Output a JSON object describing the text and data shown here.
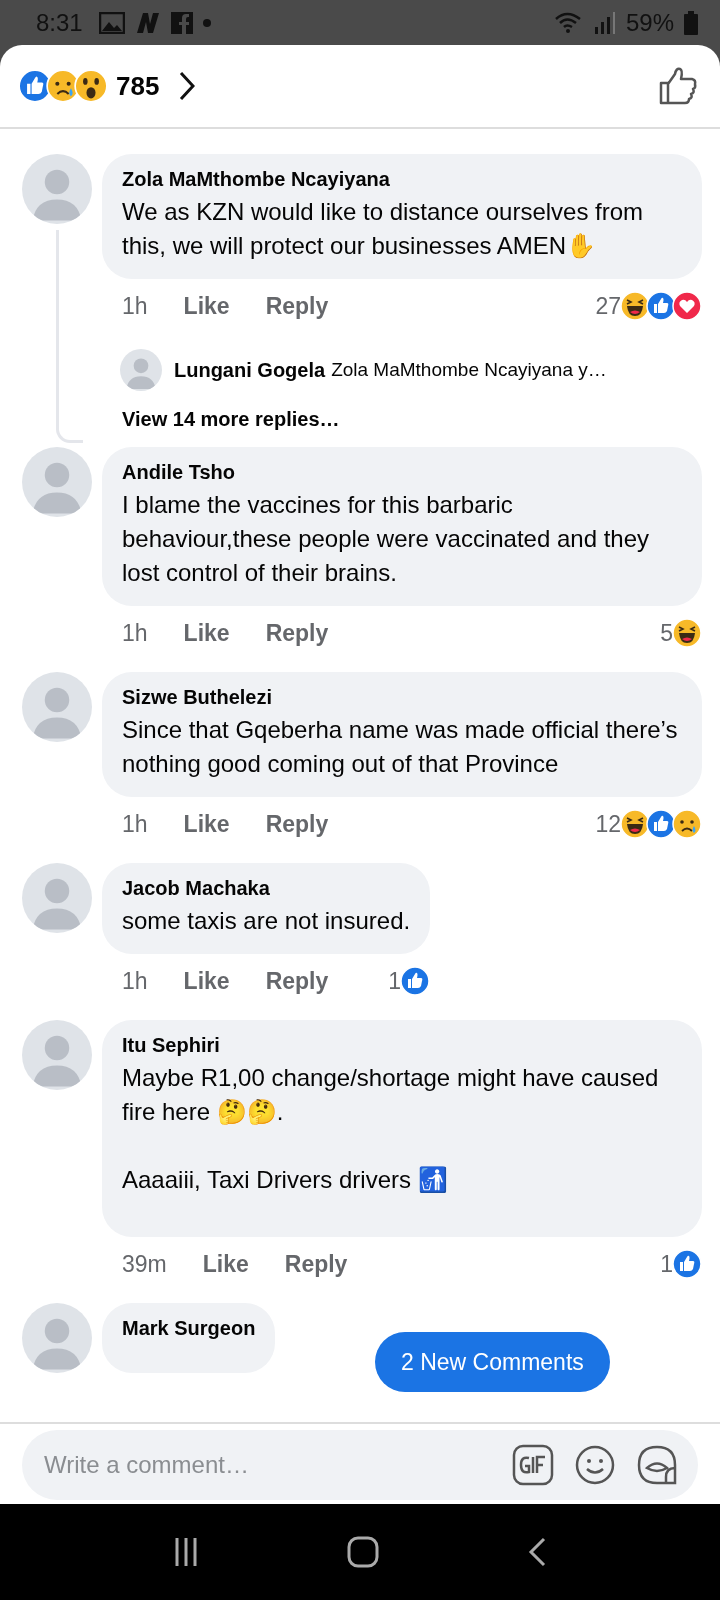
{
  "status_bar": {
    "time": "8:31",
    "battery": "59%"
  },
  "header": {
    "reactions": [
      {
        "kind": "like"
      },
      {
        "kind": "sad"
      },
      {
        "kind": "wow"
      }
    ],
    "count": "785"
  },
  "comments": [
    {
      "name": "Zola MaMthombe Ncayiyana",
      "paragraphs": [
        "We as KZN would like to distance ourselves from this, we will protect our businesses AMEN✋"
      ],
      "time": "1h",
      "like": "Like",
      "reply": "Reply",
      "reaction_count": "27",
      "reactions": [
        {
          "kind": "haha"
        },
        {
          "kind": "like"
        },
        {
          "kind": "love"
        }
      ],
      "reply_preview": {
        "name": "Lungani Gogela",
        "text": "Zola MaMthombe Ncayiyana y…"
      },
      "more_replies": "View 14 more replies…"
    },
    {
      "name": "Andile Tsho",
      "paragraphs": [
        "I blame the vaccines for this barbaric behaviour,these people were vaccinated and they lost control of their brains."
      ],
      "time": "1h",
      "like": "Like",
      "reply": "Reply",
      "reaction_count": "5",
      "reactions": [
        {
          "kind": "haha"
        }
      ]
    },
    {
      "name": "Sizwe Buthelezi",
      "paragraphs": [
        "Since that Gqeberha name was made official there’s nothing good coming out of that Province"
      ],
      "time": "1h",
      "like": "Like",
      "reply": "Reply",
      "reaction_count": "12",
      "reactions": [
        {
          "kind": "haha"
        },
        {
          "kind": "like"
        },
        {
          "kind": "sad"
        }
      ]
    },
    {
      "name": "Jacob Machaka",
      "paragraphs": [
        "some taxis are not insured."
      ],
      "time": "1h",
      "like": "Like",
      "reply": "Reply",
      "reaction_count": "1",
      "reactions": [
        {
          "kind": "like"
        }
      ]
    },
    {
      "name": "Itu Sephiri",
      "paragraphs": [
        "Maybe R1,00 change/shortage might have caused fire here 🤔🤔.",
        "Aaaaiii, Taxi Drivers drivers 🚮"
      ],
      "time": "39m",
      "like": "Like",
      "reply": "Reply",
      "reaction_count": "1",
      "reactions": [
        {
          "kind": "like"
        }
      ]
    },
    {
      "name": "Mark Surgeon"
    }
  ],
  "new_comments_pill": "2 New Comments",
  "composer": {
    "placeholder": "Write a comment…"
  }
}
